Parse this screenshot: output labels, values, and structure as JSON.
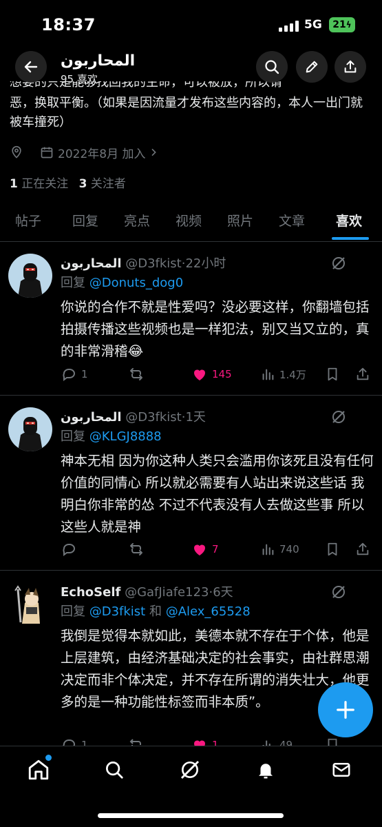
{
  "status_bar": {
    "time": "18:37",
    "network": "5G",
    "battery": "21"
  },
  "header": {
    "title": "المحاربون",
    "subtitle": "95 喜欢"
  },
  "profile": {
    "bio_clipped": "想要的只是能够找回我的生命，可以被放，所以请",
    "bio": "恶，换取平衡。（如果是因流量才发布这些内容的，本人一出门就被车撞死）",
    "joined": "2022年8月 加入",
    "following_count": "1",
    "following_label": "正在关注",
    "followers_count": "3",
    "followers_label": "关注者"
  },
  "tabs": [
    "帖子",
    "回复",
    "亮点",
    "视频",
    "照片",
    "文章",
    "喜欢"
  ],
  "active_tab": "喜欢",
  "tweets": [
    {
      "name": "المحاربون",
      "handle": "@D3fkist",
      "time": "·22小时",
      "reply_prefix": "回复 ",
      "reply_to": "@Donuts_dog0",
      "reply_joiner": "",
      "reply_to2": "",
      "text": "你说的合作不就是性爱吗？没必要这样，你翻墙包括拍摄传播这些视频也是一样犯法，别又当又立的，真的非常滑稽😂",
      "replies": "1",
      "retweets": "",
      "likes": "145",
      "views": "1.4万"
    },
    {
      "name": "المحاربون",
      "handle": "@D3fkist",
      "time": "·1天",
      "reply_prefix": "回复 ",
      "reply_to": "@KLGJ8888",
      "reply_joiner": "",
      "reply_to2": "",
      "text": "神本无相 因为你这种人类只会滥用你该死且没有任何价值的同情心 所以就必需要有人站出来说这些话 我明白你非常的怂 不过不代表没有人去做这些事 所以这些人就是神",
      "replies": "",
      "retweets": "",
      "likes": "7",
      "views": "740"
    },
    {
      "name": "EchoSelf",
      "handle": "@GafJiafe123",
      "time": "·6天",
      "reply_prefix": "回复 ",
      "reply_to": "@D3fkist",
      "reply_joiner": " 和 ",
      "reply_to2": "@Alex_65528",
      "text": "我倒是觉得本就如此，美德本就不存在于个体，他是上层建筑，由经济基础决定的社会事实，由社群思潮决定而非个体决定，并不存在所谓的消失壮大，他更多的是一种功能性标签而非本质”。",
      "replies": "1",
      "retweets": "",
      "likes": "1",
      "views": "49"
    }
  ],
  "colors": {
    "accent": "#1d9bf0",
    "like": "#f91880",
    "muted": "#71767b",
    "battery": "#4ec35a"
  },
  "icons": {
    "header": [
      "back-arrow-icon",
      "search-icon",
      "edit-pencil-icon",
      "share-icon"
    ],
    "meta": [
      "location-icon",
      "calendar-icon",
      "chevron-right-icon"
    ],
    "actions": [
      "reply-icon",
      "retweet-icon",
      "like-heart-icon",
      "views-chart-icon",
      "bookmark-icon",
      "share-icon"
    ],
    "bottom_nav": [
      "home-icon",
      "search-icon",
      "grok-icon",
      "notifications-bell-icon",
      "messages-envelope-icon"
    ],
    "fab": "plus-icon"
  }
}
